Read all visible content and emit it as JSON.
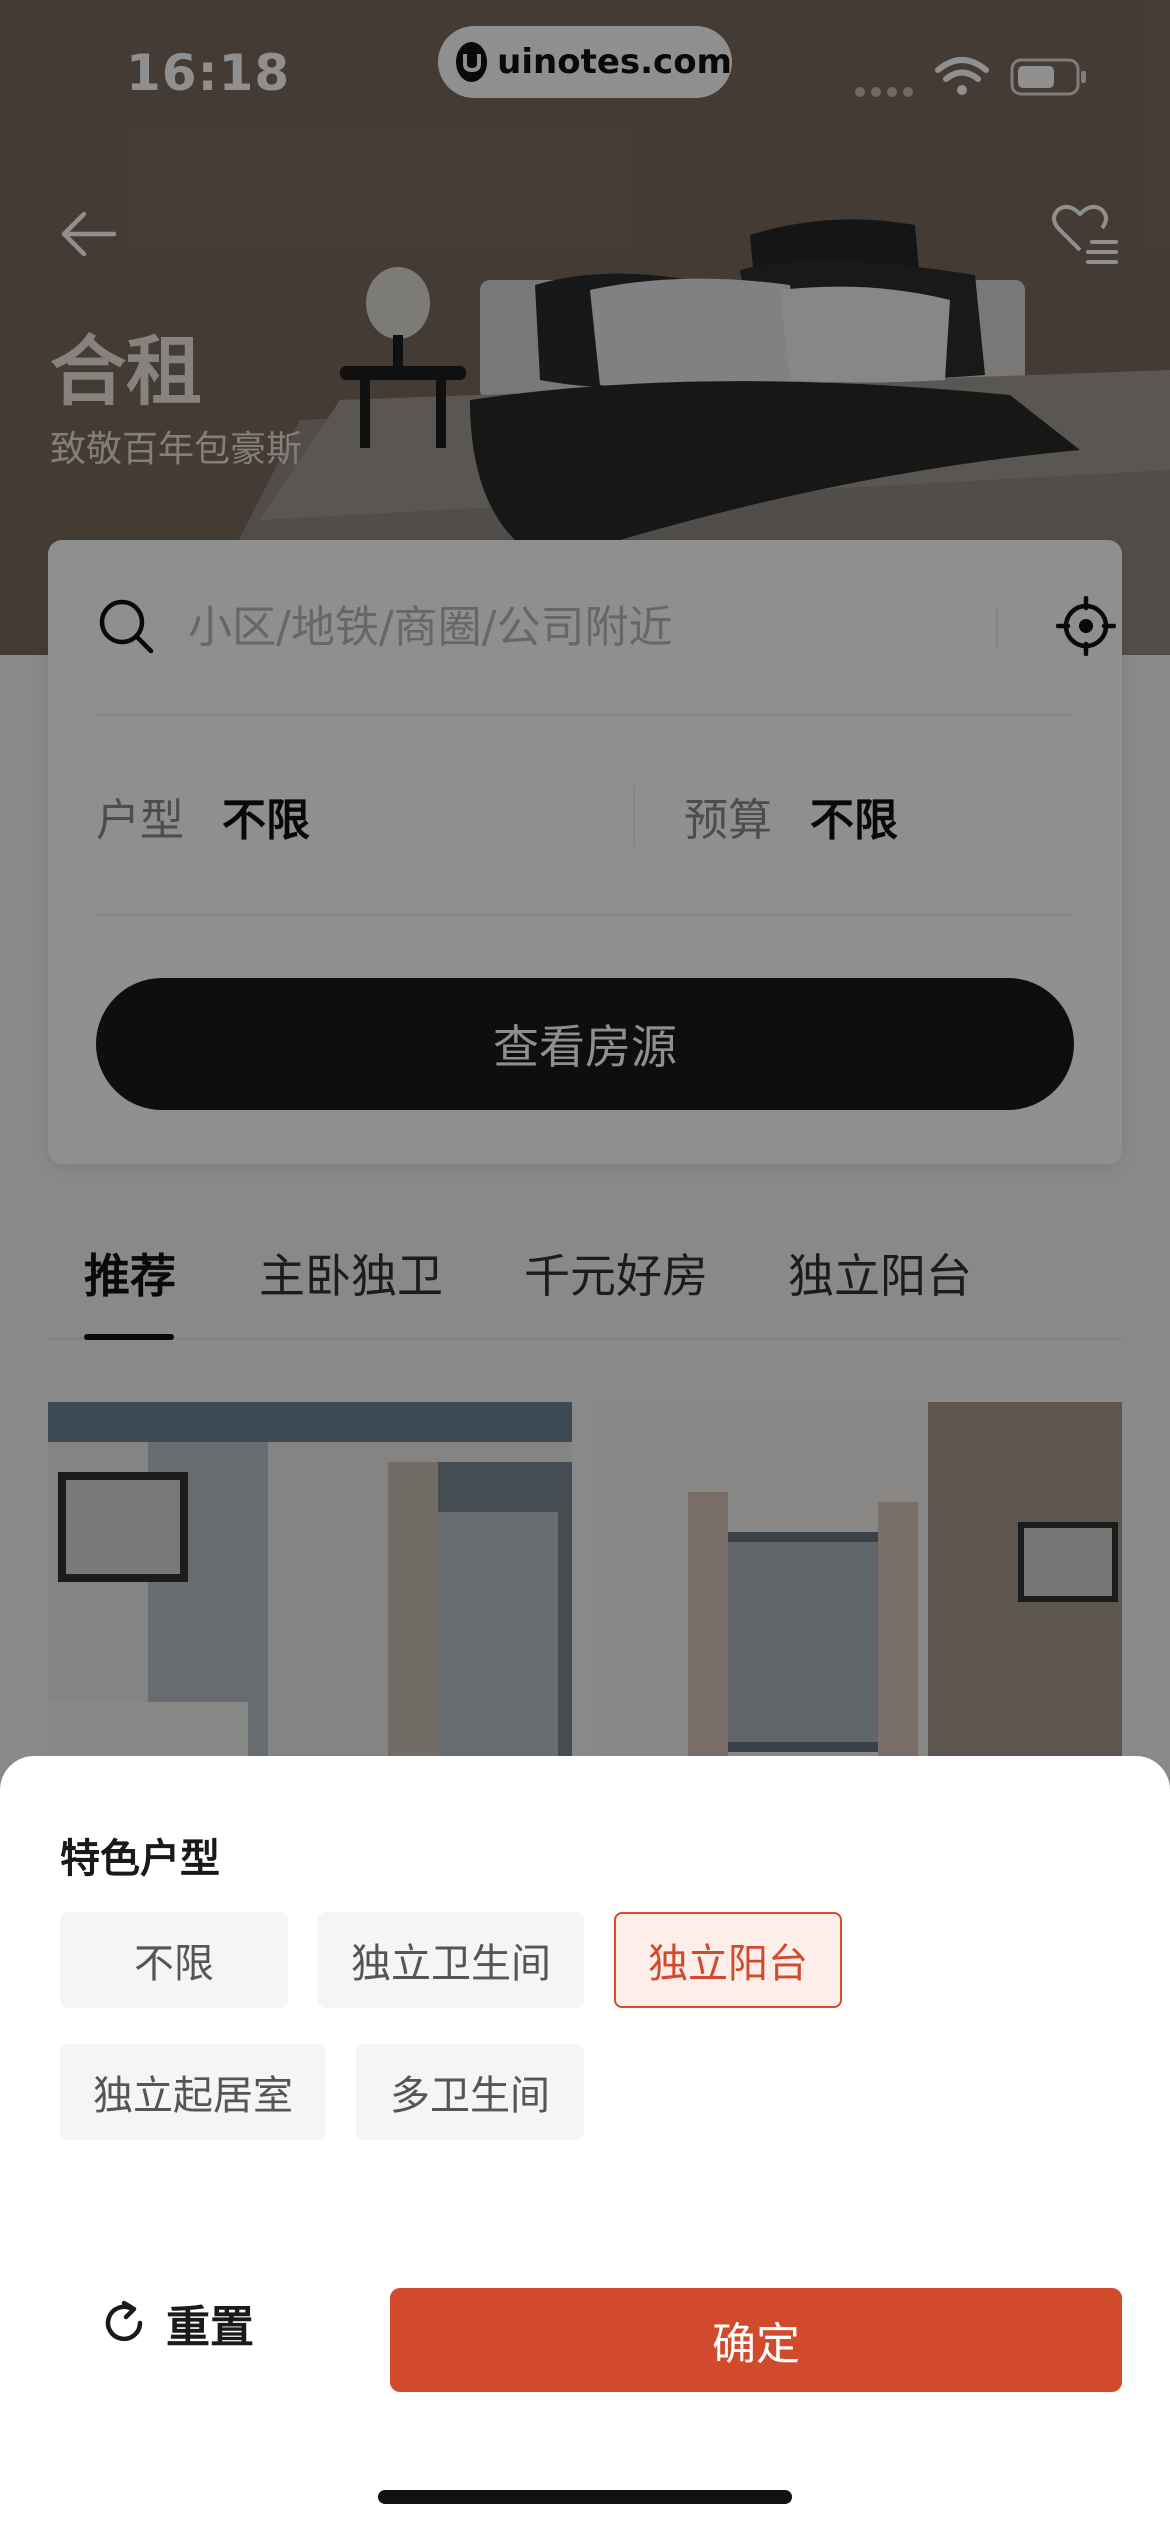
{
  "status_bar": {
    "time": "16:18",
    "url": "uinotes.com"
  },
  "hero": {
    "title": "合租",
    "subtitle": "致敬百年包豪斯"
  },
  "search": {
    "placeholder": "小区/地铁/商圈/公司附近",
    "filters": [
      {
        "label": "户型",
        "value": "不限"
      },
      {
        "label": "预算",
        "value": "不限"
      }
    ],
    "button_label": "查看房源"
  },
  "tabs": [
    {
      "label": "推荐",
      "active": true
    },
    {
      "label": "主卧独卫",
      "active": false
    },
    {
      "label": "千元好房",
      "active": false
    },
    {
      "label": "独立阳台",
      "active": false
    }
  ],
  "sheet": {
    "title": "特色户型",
    "options": [
      {
        "label": "不限",
        "selected": false
      },
      {
        "label": "独立卫生间",
        "selected": false
      },
      {
        "label": "独立阳台",
        "selected": true
      },
      {
        "label": "独立起居室",
        "selected": false
      },
      {
        "label": "多卫生间",
        "selected": false
      }
    ],
    "reset_label": "重置",
    "confirm_label": "确定"
  },
  "colors": {
    "accent": "#d24a2c",
    "selected_bg": "#fdeee9",
    "dark_button": "#1a1a1a",
    "hero_bg": "#7a6c5d"
  },
  "icons": {
    "back": "arrow-left-icon",
    "favorite": "heart-list-icon",
    "search": "search-icon",
    "locate": "crosshair-locate-icon",
    "reset": "refresh-icon"
  }
}
